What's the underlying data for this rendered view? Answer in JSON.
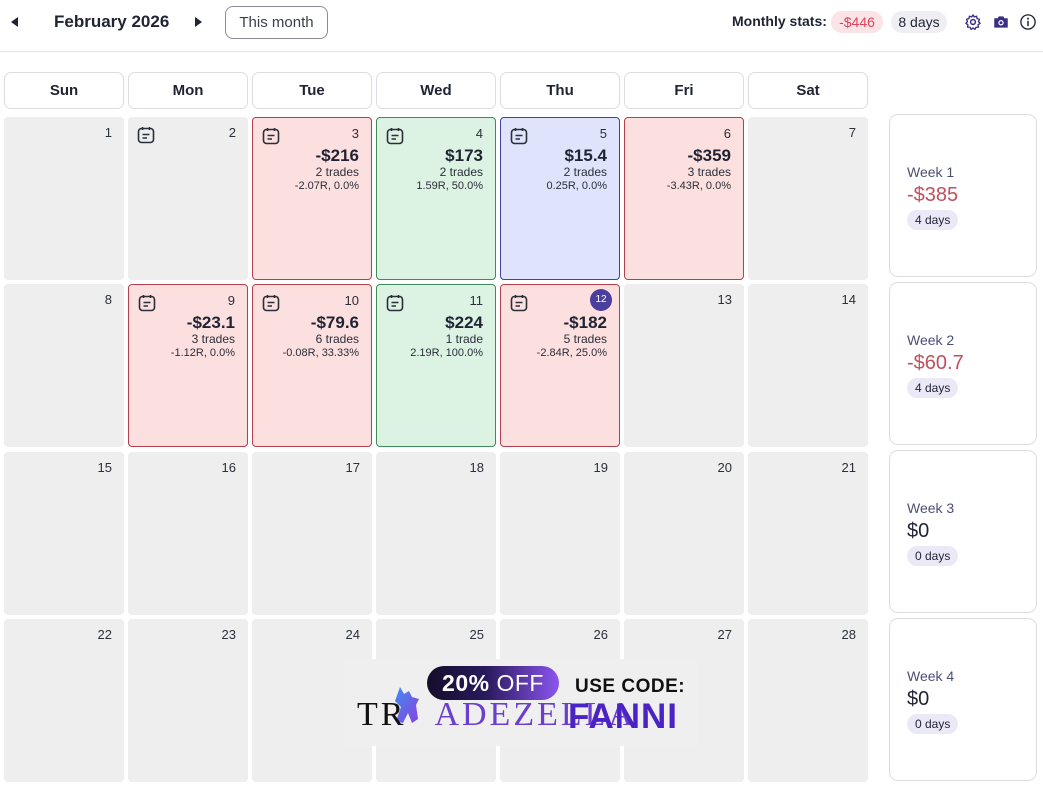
{
  "header": {
    "prev_icon": "caret-left-icon",
    "next_icon": "caret-right-icon",
    "month_title": "February 2026",
    "this_month_label": "This month",
    "stats_label": "Monthly stats:",
    "stats_pnl": "-$446",
    "stats_days": "8 days",
    "icons": [
      "gear-icon",
      "camera-icon",
      "info-icon"
    ]
  },
  "colors": {
    "loss_bg": "#fcdfdf",
    "win_bg": "#dcf2e3",
    "flat_bg": "#dfe3fb",
    "negative_text": "#c0505d",
    "today_badge": "#4b3f9e"
  },
  "weekdays": [
    "Sun",
    "Mon",
    "Tue",
    "Wed",
    "Thu",
    "Fri",
    "Sat"
  ],
  "days": [
    {
      "day": "1"
    },
    {
      "day": "2",
      "note": true
    },
    {
      "day": "3",
      "note": true,
      "status": "loss",
      "pnl": "-$216",
      "trades": "2 trades",
      "stats": "-2.07R, 0.0%"
    },
    {
      "day": "4",
      "note": true,
      "status": "win",
      "pnl": "$173",
      "trades": "2 trades",
      "stats": "1.59R, 50.0%"
    },
    {
      "day": "5",
      "note": true,
      "status": "flat",
      "pnl": "$15.4",
      "trades": "2 trades",
      "stats": "0.25R, 0.0%"
    },
    {
      "day": "6",
      "status": "loss",
      "pnl": "-$359",
      "trades": "3 trades",
      "stats": "-3.43R, 0.0%"
    },
    {
      "day": "7"
    },
    {
      "day": "8"
    },
    {
      "day": "9",
      "note": true,
      "status": "loss",
      "pnl": "-$23.1",
      "trades": "3 trades",
      "stats": "-1.12R, 0.0%"
    },
    {
      "day": "10",
      "note": true,
      "status": "loss",
      "pnl": "-$79.6",
      "trades": "6 trades",
      "stats": "-0.08R, 33.33%"
    },
    {
      "day": "11",
      "note": true,
      "status": "win",
      "pnl": "$224",
      "trades": "1 trade",
      "stats": "2.19R, 100.0%"
    },
    {
      "day": "12",
      "note": true,
      "status": "loss",
      "today": true,
      "pnl": "-$182",
      "trades": "5 trades",
      "stats": "-2.84R, 25.0%"
    },
    {
      "day": "13"
    },
    {
      "day": "14"
    },
    {
      "day": "15"
    },
    {
      "day": "16"
    },
    {
      "day": "17"
    },
    {
      "day": "18"
    },
    {
      "day": "19"
    },
    {
      "day": "20"
    },
    {
      "day": "21"
    },
    {
      "day": "22"
    },
    {
      "day": "23"
    },
    {
      "day": "24"
    },
    {
      "day": "25"
    },
    {
      "day": "26"
    },
    {
      "day": "27"
    },
    {
      "day": "28"
    }
  ],
  "weeks": [
    {
      "label": "Week 1",
      "pnl": "-$385",
      "days": "4 days",
      "negative": true
    },
    {
      "label": "Week 2",
      "pnl": "-$60.7",
      "days": "4 days",
      "negative": true
    },
    {
      "label": "Week 3",
      "pnl": "$0",
      "days": "0 days",
      "negative": false
    },
    {
      "label": "Week 4",
      "pnl": "$0",
      "days": "0 days",
      "negative": false
    }
  ],
  "promo": {
    "discount_percent": "20%",
    "discount_word": "OFF",
    "use_code_label": "USE CODE:",
    "brand_head": "TR",
    "brand_tail": "ADEZELLA",
    "code": "FANNI"
  }
}
